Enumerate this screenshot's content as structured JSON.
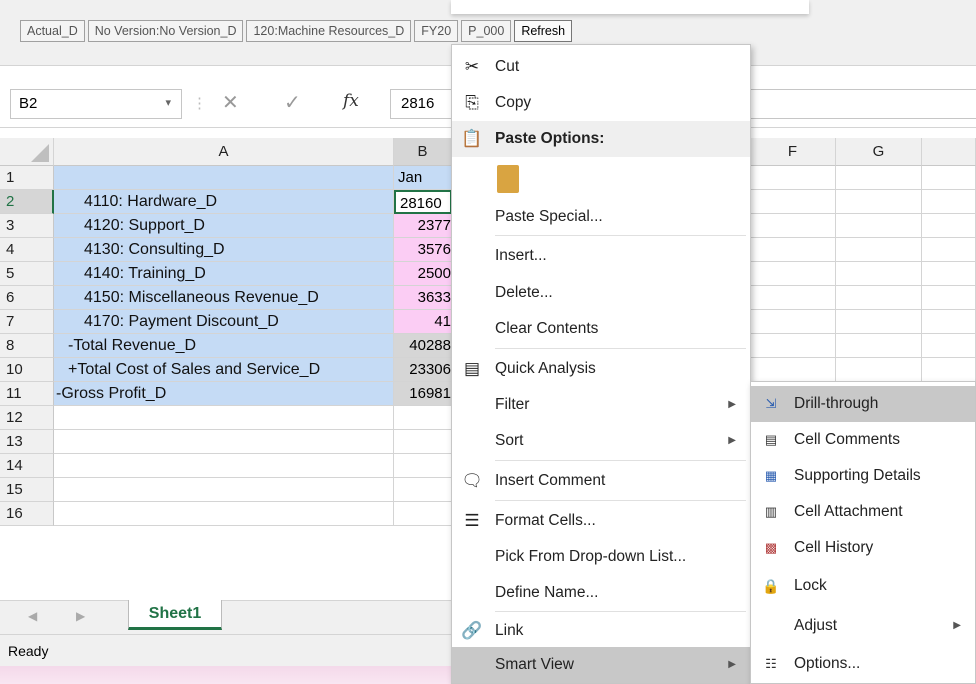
{
  "pov": {
    "items": [
      "Actual_D",
      "No Version:No Version_D",
      "120:Machine Resources_D",
      "FY20",
      "P_000"
    ],
    "refresh": "Refresh"
  },
  "formula": {
    "cell": "B2",
    "value": "2816",
    "fx": "fx"
  },
  "columns": {
    "a": "A",
    "b": "B",
    "f": "F",
    "g": "G"
  },
  "rows": [
    {
      "num": "1",
      "a": "",
      "b": "Jan"
    },
    {
      "num": "2",
      "a": "4110: Hardware_D",
      "b": "28160"
    },
    {
      "num": "3",
      "a": "4120: Support_D",
      "b": "2377"
    },
    {
      "num": "4",
      "a": "4130: Consulting_D",
      "b": "3576"
    },
    {
      "num": "5",
      "a": "4140: Training_D",
      "b": "2500"
    },
    {
      "num": "6",
      "a": "4150: Miscellaneous Revenue_D",
      "b": "3633"
    },
    {
      "num": "7",
      "a": "4170: Payment Discount_D",
      "b": "41"
    },
    {
      "num": "8",
      "a": "-Total Revenue_D",
      "b": "40288"
    },
    {
      "num": "10",
      "a": "+Total Cost of Sales and Service_D",
      "b": "23306"
    },
    {
      "num": "11",
      "a": "-Gross Profit_D",
      "b": "16981"
    },
    {
      "num": "12",
      "a": "",
      "b": ""
    },
    {
      "num": "13",
      "a": "",
      "b": ""
    },
    {
      "num": "14",
      "a": "",
      "b": ""
    },
    {
      "num": "15",
      "a": "",
      "b": ""
    },
    {
      "num": "16",
      "a": "",
      "b": ""
    }
  ],
  "sheet_tab": "Sheet1",
  "status": "Ready",
  "context_menu": {
    "cut": "Cut",
    "copy": "Copy",
    "paste_options": "Paste Options:",
    "paste_special": "Paste Special...",
    "insert": "Insert...",
    "delete": "Delete...",
    "clear_contents": "Clear Contents",
    "quick_analysis": "Quick Analysis",
    "filter": "Filter",
    "sort": "Sort",
    "insert_comment": "Insert Comment",
    "format_cells": "Format Cells...",
    "pick_list": "Pick From Drop-down List...",
    "define_name": "Define Name...",
    "link": "Link",
    "smart_view": "Smart View"
  },
  "smart_view_menu": {
    "drill_through": "Drill-through",
    "cell_comments": "Cell Comments",
    "supporting_details": "Supporting Details",
    "cell_attachment": "Cell Attachment",
    "cell_history": "Cell History",
    "lock": "Lock",
    "adjust": "Adjust",
    "options": "Options..."
  },
  "colors": {
    "blue_cell": "#c5dbf5",
    "pink_cell": "#fbcdf4",
    "grey_cell": "#d6d6d6",
    "excel_green": "#217346"
  }
}
